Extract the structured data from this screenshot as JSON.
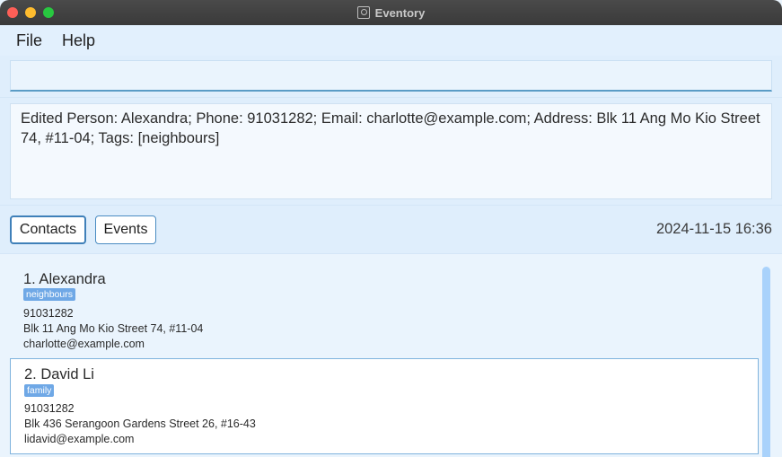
{
  "window": {
    "title": "Eventory"
  },
  "menu": {
    "file": "File",
    "help": "Help"
  },
  "command": {
    "value": ""
  },
  "result": {
    "text": "Edited Person: Alexandra; Phone: 91031282; Email: charlotte@example.com; Address: Blk 11 Ang Mo Kio Street 74, #11-04; Tags: [neighbours]"
  },
  "tabs": {
    "contacts": "Contacts",
    "events": "Events"
  },
  "datetime": "2024-11-15 16:36",
  "contacts": [
    {
      "name": "1. Alexandra",
      "tag": "neighbours",
      "phone": "91031282",
      "address": "Blk 11 Ang Mo Kio Street 74, #11-04",
      "email": "charlotte@example.com"
    },
    {
      "name": "2. David Li",
      "tag": "family",
      "phone": "91031282",
      "address": "Blk 436 Serangoon Gardens Street 26, #16-43",
      "email": "lidavid@example.com"
    }
  ],
  "colors": {
    "tag": "#6fa8e6",
    "selected_border": "#7fb3dd",
    "accent": "#3f80b9"
  }
}
